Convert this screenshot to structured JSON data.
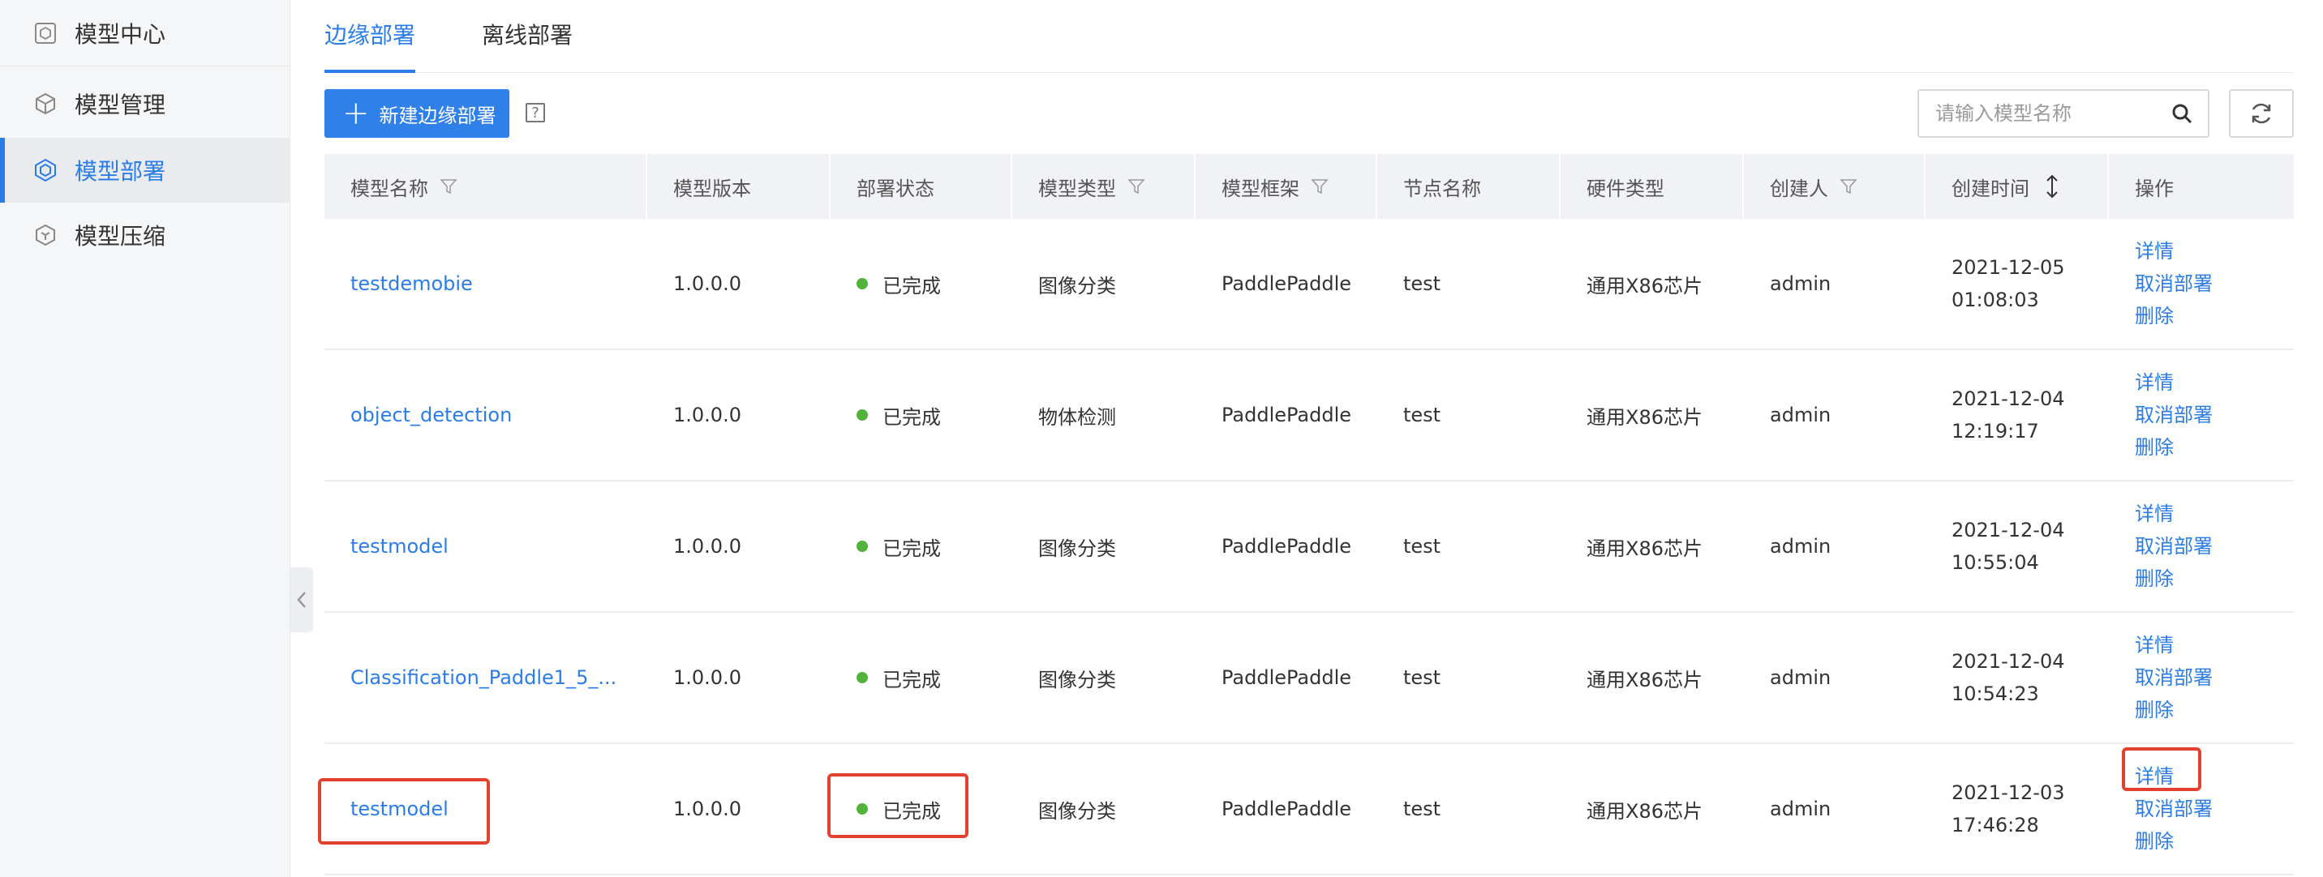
{
  "sidebar": {
    "header": "模型中心",
    "items": [
      {
        "label": "模型管理",
        "icon": "cube-icon"
      },
      {
        "label": "模型部署",
        "icon": "deploy-icon",
        "active": true
      },
      {
        "label": "模型压缩",
        "icon": "compress-icon"
      }
    ]
  },
  "tabs": [
    {
      "label": "边缘部署",
      "active": true
    },
    {
      "label": "离线部署",
      "active": false
    }
  ],
  "toolbar": {
    "new_button": "新建边缘部署",
    "help_glyph": "?",
    "search_placeholder": "请输入模型名称"
  },
  "table": {
    "columns": [
      "模型名称",
      "模型版本",
      "部署状态",
      "模型类型",
      "模型框架",
      "节点名称",
      "硬件类型",
      "创建人",
      "创建时间",
      "操作"
    ],
    "rows": [
      {
        "name": "testdemobie",
        "version": "1.0.0.0",
        "status": "已完成",
        "type": "图像分类",
        "framework": "PaddlePaddle",
        "node": "test",
        "hardware": "通用X86芯片",
        "creator": "admin",
        "date": "2021-12-05",
        "time": "01:08:03"
      },
      {
        "name": "object_detection",
        "version": "1.0.0.0",
        "status": "已完成",
        "type": "物体检测",
        "framework": "PaddlePaddle",
        "node": "test",
        "hardware": "通用X86芯片",
        "creator": "admin",
        "date": "2021-12-04",
        "time": "12:19:17"
      },
      {
        "name": "testmodel",
        "version": "1.0.0.0",
        "status": "已完成",
        "type": "图像分类",
        "framework": "PaddlePaddle",
        "node": "test",
        "hardware": "通用X86芯片",
        "creator": "admin",
        "date": "2021-12-04",
        "time": "10:55:04"
      },
      {
        "name": "Classification_Paddle1_5_...",
        "version": "1.0.0.0",
        "status": "已完成",
        "type": "图像分类",
        "framework": "PaddlePaddle",
        "node": "test",
        "hardware": "通用X86芯片",
        "creator": "admin",
        "date": "2021-12-04",
        "time": "10:54:23"
      },
      {
        "name": "testmodel",
        "version": "1.0.0.0",
        "status": "已完成",
        "type": "图像分类",
        "framework": "PaddlePaddle",
        "node": "test",
        "hardware": "通用X86芯片",
        "creator": "admin",
        "date": "2021-12-03",
        "time": "17:46:28"
      }
    ],
    "actions": [
      "详情",
      "取消部署",
      "删除"
    ]
  },
  "colors": {
    "accent": "#2a7de8",
    "status_done": "#52b33a",
    "highlight": "#e3412f"
  }
}
